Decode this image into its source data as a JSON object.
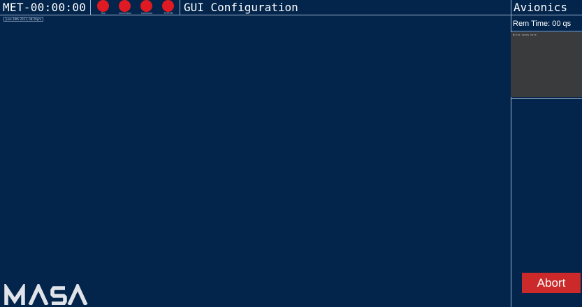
{
  "header": {
    "met_clock": "MET-00:00:00",
    "gui_title": "GUI Configuration",
    "panel_title": "Avionics",
    "indicators": [
      {
        "label": "Run",
        "status_color": "#e01a22"
      },
      {
        "label": "Connection",
        "status_color": "#e01a22"
      },
      {
        "label": "Command",
        "status_color": "#e01a22"
      },
      {
        "label": "SYSTEM",
        "status_color": "#e01a22"
      }
    ]
  },
  "main": {
    "date_stamp": "June 28th 2021, 08:29pm"
  },
  "side_panel": {
    "rem_time": "Rem Time: 00 qs",
    "notes_placeholder": "Write notes here",
    "notes_value": "",
    "abort_label": "Abort"
  },
  "logo": {
    "text": "MASA",
    "color": "#ffffff"
  },
  "colors": {
    "background": "#03254c",
    "divider": "#9fb4cc",
    "status_red": "#e01a22",
    "abort_red": "#cc2a2a",
    "notes_bg": "#3a3b3c"
  }
}
